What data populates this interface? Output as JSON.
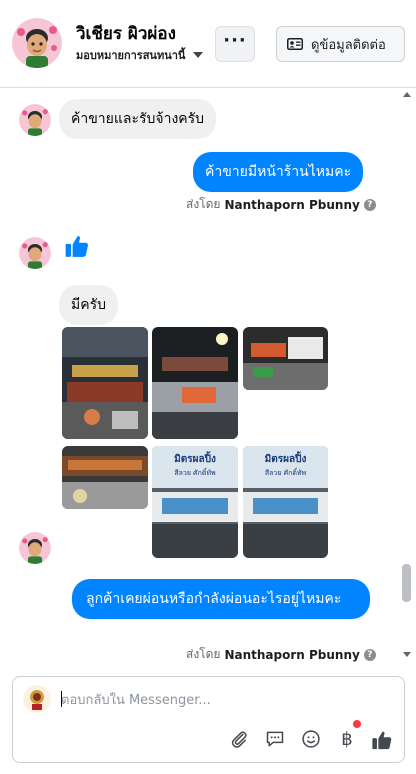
{
  "header": {
    "contact_name": "วิเชียร ผิวผ่อง",
    "subtitle": "มอบหมายการสนทนานี้",
    "more_label": "···",
    "contact_info_label": "ดูข้อมูลติดต่อ"
  },
  "messages": [
    {
      "direction": "in",
      "text": "ค้าขายและรับจ้างครับ"
    },
    {
      "direction": "out",
      "text": "ค้าขายมีหน้าร้านไหมคะ",
      "sent_by_prefix": "ส่งโดย",
      "sent_by_name": "Nanthaporn Pbunny"
    },
    {
      "direction": "in",
      "type": "like",
      "icon": "thumbs-up-icon"
    },
    {
      "direction": "in",
      "text": "มีครับ"
    },
    {
      "direction": "in",
      "type": "photos",
      "count": 6
    },
    {
      "direction": "out",
      "text": "ลูกค้าเคยผ่อนหรือกำลังผ่อนอะไรอยู่ไหมคะ",
      "sent_by_prefix": "ส่งโดย",
      "sent_by_name": "Nanthaporn Pbunny"
    }
  ],
  "photo_texts": {
    "sign_line1": "มิตรผลปิ้ง",
    "sign_line2": "สีลวย ศักดิ์ทัพ"
  },
  "composer": {
    "placeholder": "ตอบกลับใน Messenger...",
    "tools": [
      "paperclip-icon",
      "speech-bubble-icon",
      "emoji-icon",
      "baht-icon",
      "thumbs-up-icon"
    ]
  },
  "colors": {
    "outgoing_bubble": "#0084ff",
    "incoming_bubble": "#f0f0f0",
    "like_blue": "#0084ff",
    "notification_dot": "#fa383e"
  }
}
